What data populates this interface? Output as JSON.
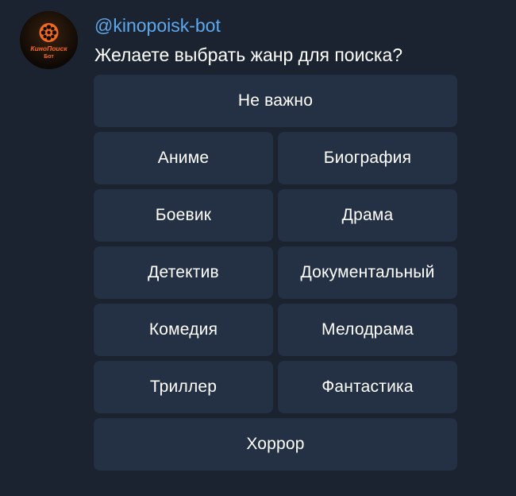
{
  "chat": {
    "avatar": {
      "icon": "kinopoisk-film-reel-logo",
      "logo_text_top": "КиноПоиск",
      "logo_text_bottom": "Бот",
      "accent": "#f26a1b"
    },
    "sender": "@kinopoisk-bot",
    "message": "Желаете выбрать жанр для поиска?"
  },
  "keyboard": {
    "rows": [
      [
        "Не важно"
      ],
      [
        "Аниме",
        "Биография"
      ],
      [
        "Боевик",
        "Драма"
      ],
      [
        "Детектив",
        "Документальный"
      ],
      [
        "Комедия",
        "Мелодрама"
      ],
      [
        "Триллер",
        "Фантастика"
      ],
      [
        "Хоррор"
      ]
    ]
  },
  "colors": {
    "background": "#1b2330",
    "button": "#243044",
    "sender": "#5fa8ec",
    "text": "#ffffff"
  }
}
